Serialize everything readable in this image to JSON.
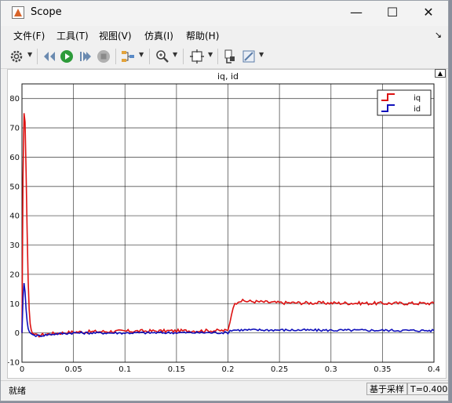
{
  "window": {
    "title": "Scope",
    "minimize": "—",
    "maximize": "☐",
    "close": "✕"
  },
  "menu": [
    "文件(F)",
    "工具(T)",
    "视图(V)",
    "仿真(I)",
    "帮助(H)"
  ],
  "menu_corner": "↘",
  "toolbar": {
    "icons": [
      "gear-icon",
      "rewind-icon",
      "run-icon",
      "step-forward-icon",
      "stop-icon",
      "signal-selector-icon",
      "zoom-icon",
      "autoscale-icon",
      "cursor-measure-icon",
      "style-icon"
    ]
  },
  "status": {
    "left": "就绪",
    "mode": "基于采样",
    "time": "T=0.400"
  },
  "colors": {
    "iq": "#dd1111",
    "id": "#1111bb",
    "grid": "#1a1a1a",
    "background": "#ffffff"
  },
  "chart_data": {
    "type": "line",
    "title": "iq, id",
    "xlabel": "",
    "ylabel": "",
    "xlim": [
      0,
      0.4
    ],
    "ylim": [
      -10,
      85
    ],
    "xticks": [
      0,
      0.05,
      0.1,
      0.15,
      0.2,
      0.25,
      0.3,
      0.35,
      0.4
    ],
    "xtick_labels": [
      "0",
      "0.05",
      "0.1",
      "0.15",
      "0.2",
      "0.25",
      "0.3",
      "0.35",
      "0.4"
    ],
    "yticks": [
      -10,
      0,
      10,
      20,
      30,
      40,
      50,
      60,
      70,
      80
    ],
    "ytick_labels": [
      "-10",
      "0",
      "10",
      "20",
      "30",
      "40",
      "50",
      "60",
      "70",
      "80"
    ],
    "grid": true,
    "legend": "top-right",
    "series": [
      {
        "name": "iq",
        "x": [
          0,
          0.001,
          0.002,
          0.003,
          0.004,
          0.005,
          0.006,
          0.007,
          0.008,
          0.009,
          0.01,
          0.012,
          0.015,
          0.02,
          0.03,
          0.05,
          0.1,
          0.15,
          0.2,
          0.202,
          0.205,
          0.21,
          0.22,
          0.25,
          0.3,
          0.35,
          0.4
        ],
        "y": [
          0,
          53,
          75,
          72,
          55,
          35,
          18,
          8,
          3,
          1,
          0,
          -0.5,
          -1,
          -0.6,
          -0.2,
          0.3,
          0.6,
          0.7,
          0.8,
          4,
          9,
          11,
          10.8,
          10.3,
          10.2,
          10.1,
          10.1
        ]
      },
      {
        "name": "id",
        "x": [
          0,
          0.001,
          0.002,
          0.003,
          0.004,
          0.005,
          0.006,
          0.007,
          0.008,
          0.01,
          0.012,
          0.015,
          0.02,
          0.03,
          0.05,
          0.1,
          0.15,
          0.2,
          0.202,
          0.205,
          0.21,
          0.25,
          0.3,
          0.35,
          0.4
        ],
        "y": [
          0,
          12,
          17,
          14,
          8,
          4,
          1.5,
          0.5,
          0,
          -0.5,
          -0.8,
          -1,
          -0.8,
          -0.4,
          0,
          0,
          0.1,
          0.1,
          0.8,
          1.0,
          1.0,
          1.0,
          0.9,
          0.9,
          0.8
        ]
      }
    ]
  }
}
